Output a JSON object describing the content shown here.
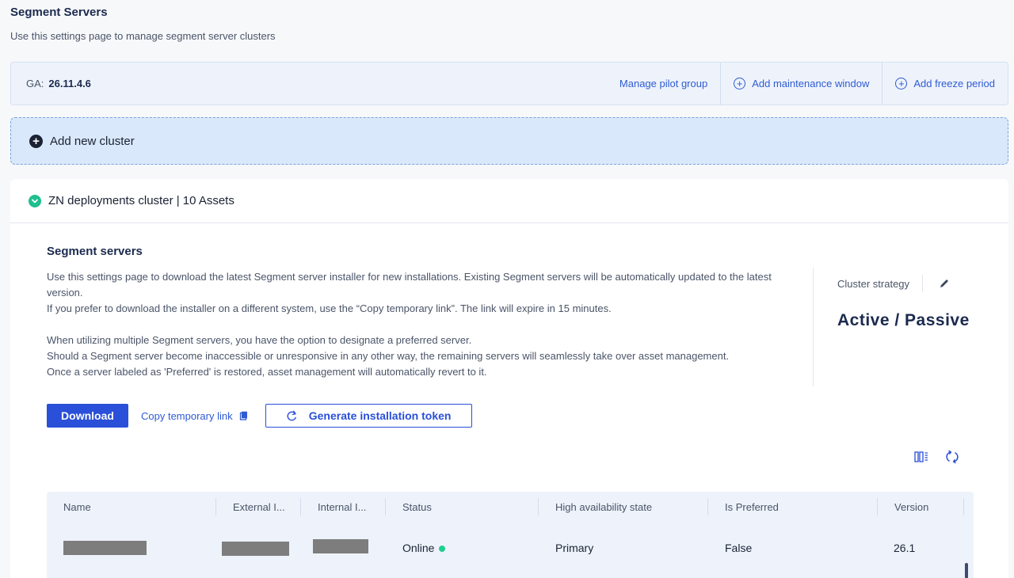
{
  "page": {
    "title": "Segment Servers",
    "subtitle": "Use this settings page to manage segment server clusters"
  },
  "ga_bar": {
    "label": "GA:",
    "version": "26.11.4.6",
    "manage_pilot": "Manage pilot group",
    "add_maintenance": "Add maintenance window",
    "add_freeze": "Add freeze period"
  },
  "add_cluster": {
    "label": "Add new cluster"
  },
  "cluster": {
    "title": "ZN deployments cluster | 10 Assets",
    "section_title": "Segment servers",
    "desc": {
      "line1": "Use this settings page to download the latest Segment server installer for new installations. Existing Segment servers will be automatically updated to the latest version.",
      "line2": "If you prefer to download the installer on a different system, use the “Copy temporary link”. The link will expire in 15 minutes.",
      "line3": "When utilizing multiple Segment servers, you have the option to designate a preferred server.",
      "line4": "Should a Segment server become inaccessible or unresponsive in any other way, the remaining servers will seamlessly take over asset management.",
      "line5": "Once a server labeled as 'Preferred' is restored, asset management will automatically revert to it."
    },
    "strategy": {
      "label": "Cluster strategy",
      "value": "Active / Passive"
    },
    "buttons": {
      "download": "Download",
      "copy_link": "Copy temporary link",
      "generate_token": "Generate installation token"
    },
    "table": {
      "columns": [
        "Name",
        "External I...",
        "Internal I...",
        "Status",
        "High availability state",
        "Is Preferred",
        "Version"
      ],
      "rows": [
        {
          "status": "Online",
          "ha_state": "Primary",
          "is_preferred": "False",
          "version": "26.1"
        }
      ]
    }
  },
  "colors": {
    "accent": "#2a4fd8",
    "online": "#1fcf8f",
    "check": "#1fbf8f"
  }
}
